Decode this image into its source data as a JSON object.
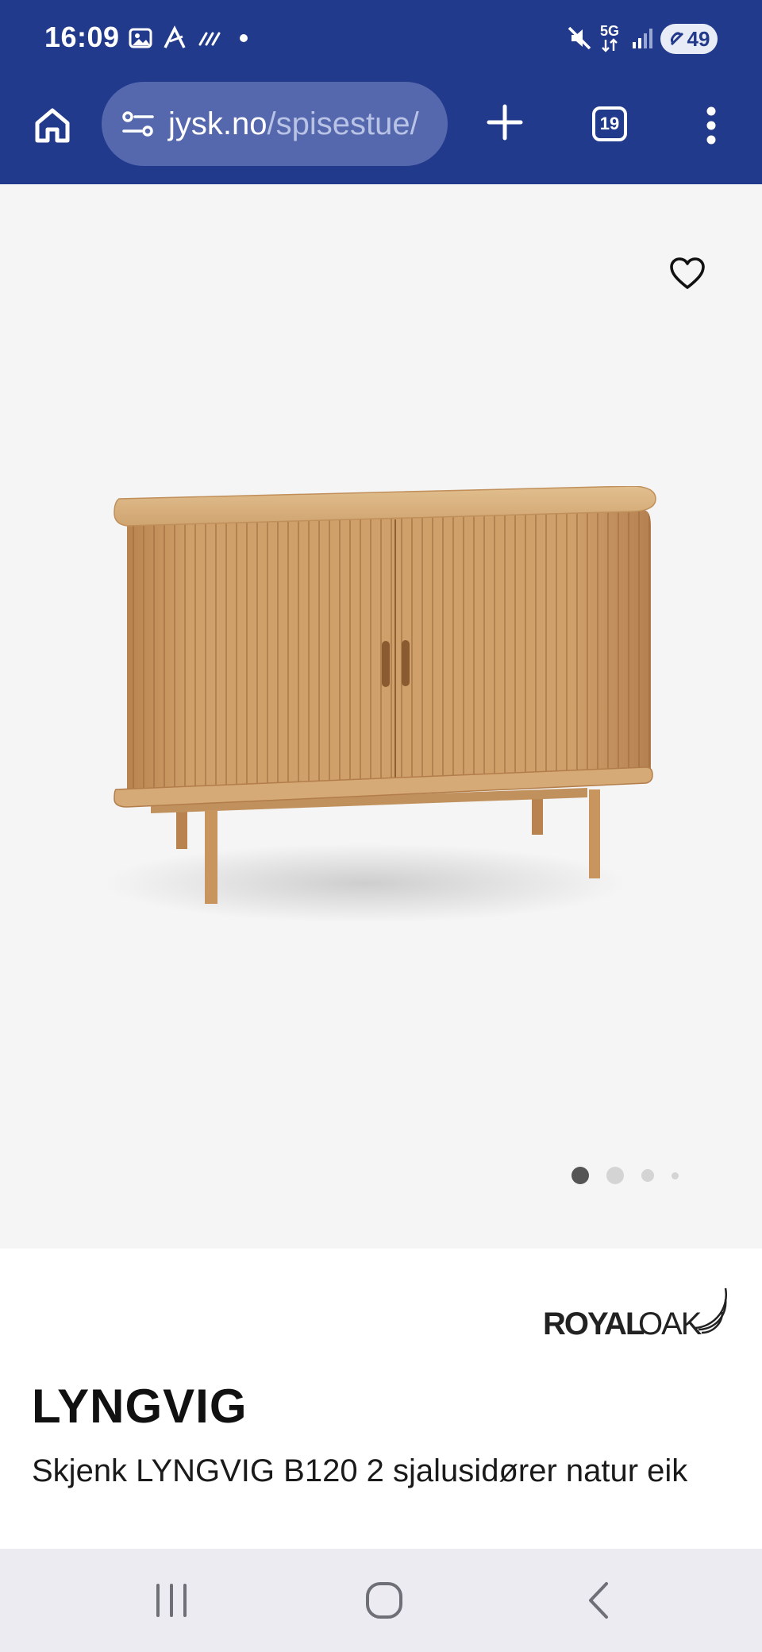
{
  "status_bar": {
    "time": "16:09",
    "network": "5G",
    "battery": "49",
    "icons": [
      "screenshot-icon",
      "app-notification-icon",
      "signal-activity-icon",
      "dot-icon",
      "mute-icon",
      "5g-icon",
      "signal-bars-icon",
      "battery-icon"
    ]
  },
  "browser": {
    "url_domain": "jysk.no",
    "url_path": "/spisestue/",
    "tab_count": "19",
    "icons": [
      "home-icon",
      "site-info-icon",
      "plus-icon",
      "tabs-icon",
      "more-vert-icon"
    ]
  },
  "gallery": {
    "image_count": 4,
    "active_index": 0,
    "favourite_icon": "heart-outline-icon",
    "background": "#f5f5f5"
  },
  "product": {
    "brand": "ROYALOAK",
    "brand_parts": [
      "ROYAL",
      "OAK"
    ],
    "name": "LYNGVIG",
    "description": "Skjenk LYNGVIG B120 2 sjalusidører natur eik"
  },
  "system_nav": {
    "icons": [
      "recents-icon",
      "home-circle-icon",
      "back-icon"
    ]
  },
  "colors": {
    "chrome": "#223a8c",
    "omnibox": "#5567ad",
    "wood": "#c99a63",
    "navbar": "#ebebf1"
  }
}
